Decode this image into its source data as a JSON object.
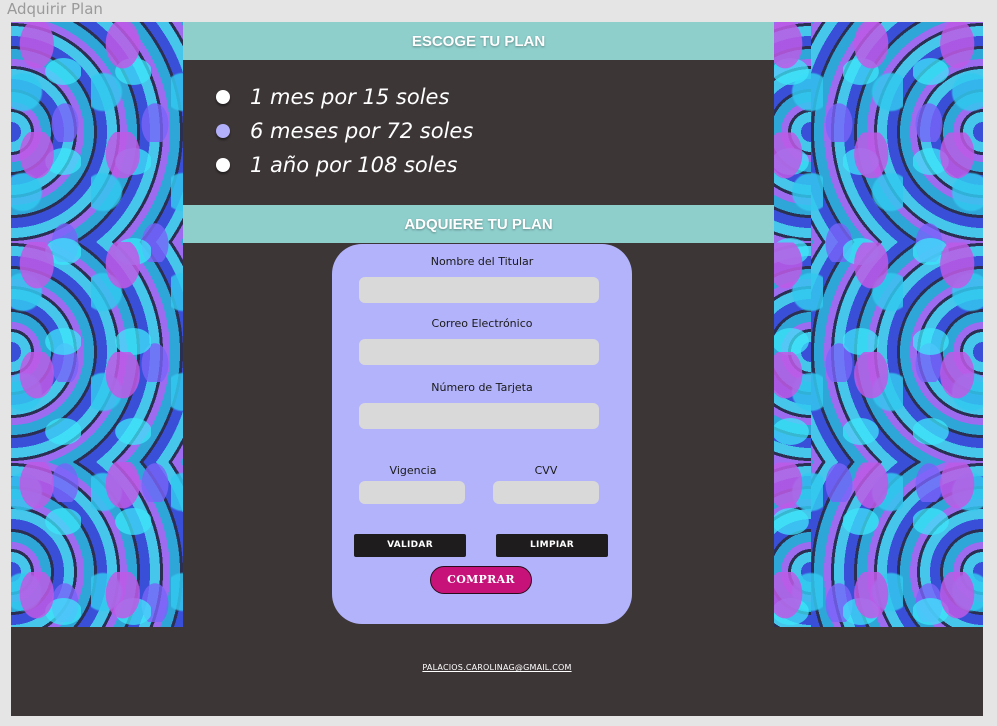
{
  "frame": {
    "title": "Adquirir Plan"
  },
  "plans": {
    "header": "ESCOGE TU PLAN",
    "options": [
      {
        "label": "1 mes por 15 soles",
        "selected": false
      },
      {
        "label": "6 meses por 72 soles",
        "selected": true
      },
      {
        "label": "1 año por 108 soles",
        "selected": false
      }
    ]
  },
  "purchase": {
    "header": "ADQUIERE TU PLAN",
    "fields": {
      "holder_label": "Nombre  del Titular",
      "email_label": "Correo Electrónico",
      "card_label": "Número de Tarjeta",
      "validity_label": "Vigencia",
      "cvv_label": "CVV"
    },
    "buttons": {
      "validate": "VALIDAR",
      "clear": "LIMPIAR",
      "buy": "COMPRAR"
    }
  },
  "footer": {
    "email": "PALACIOS.CAROLINAG@GMAIL.COM"
  },
  "colors": {
    "band": "#8ecfcc",
    "background": "#3d3637",
    "card": "#b3b3fb",
    "selected_dot": "#b3b0fb",
    "buy_button": "#c7127a"
  }
}
